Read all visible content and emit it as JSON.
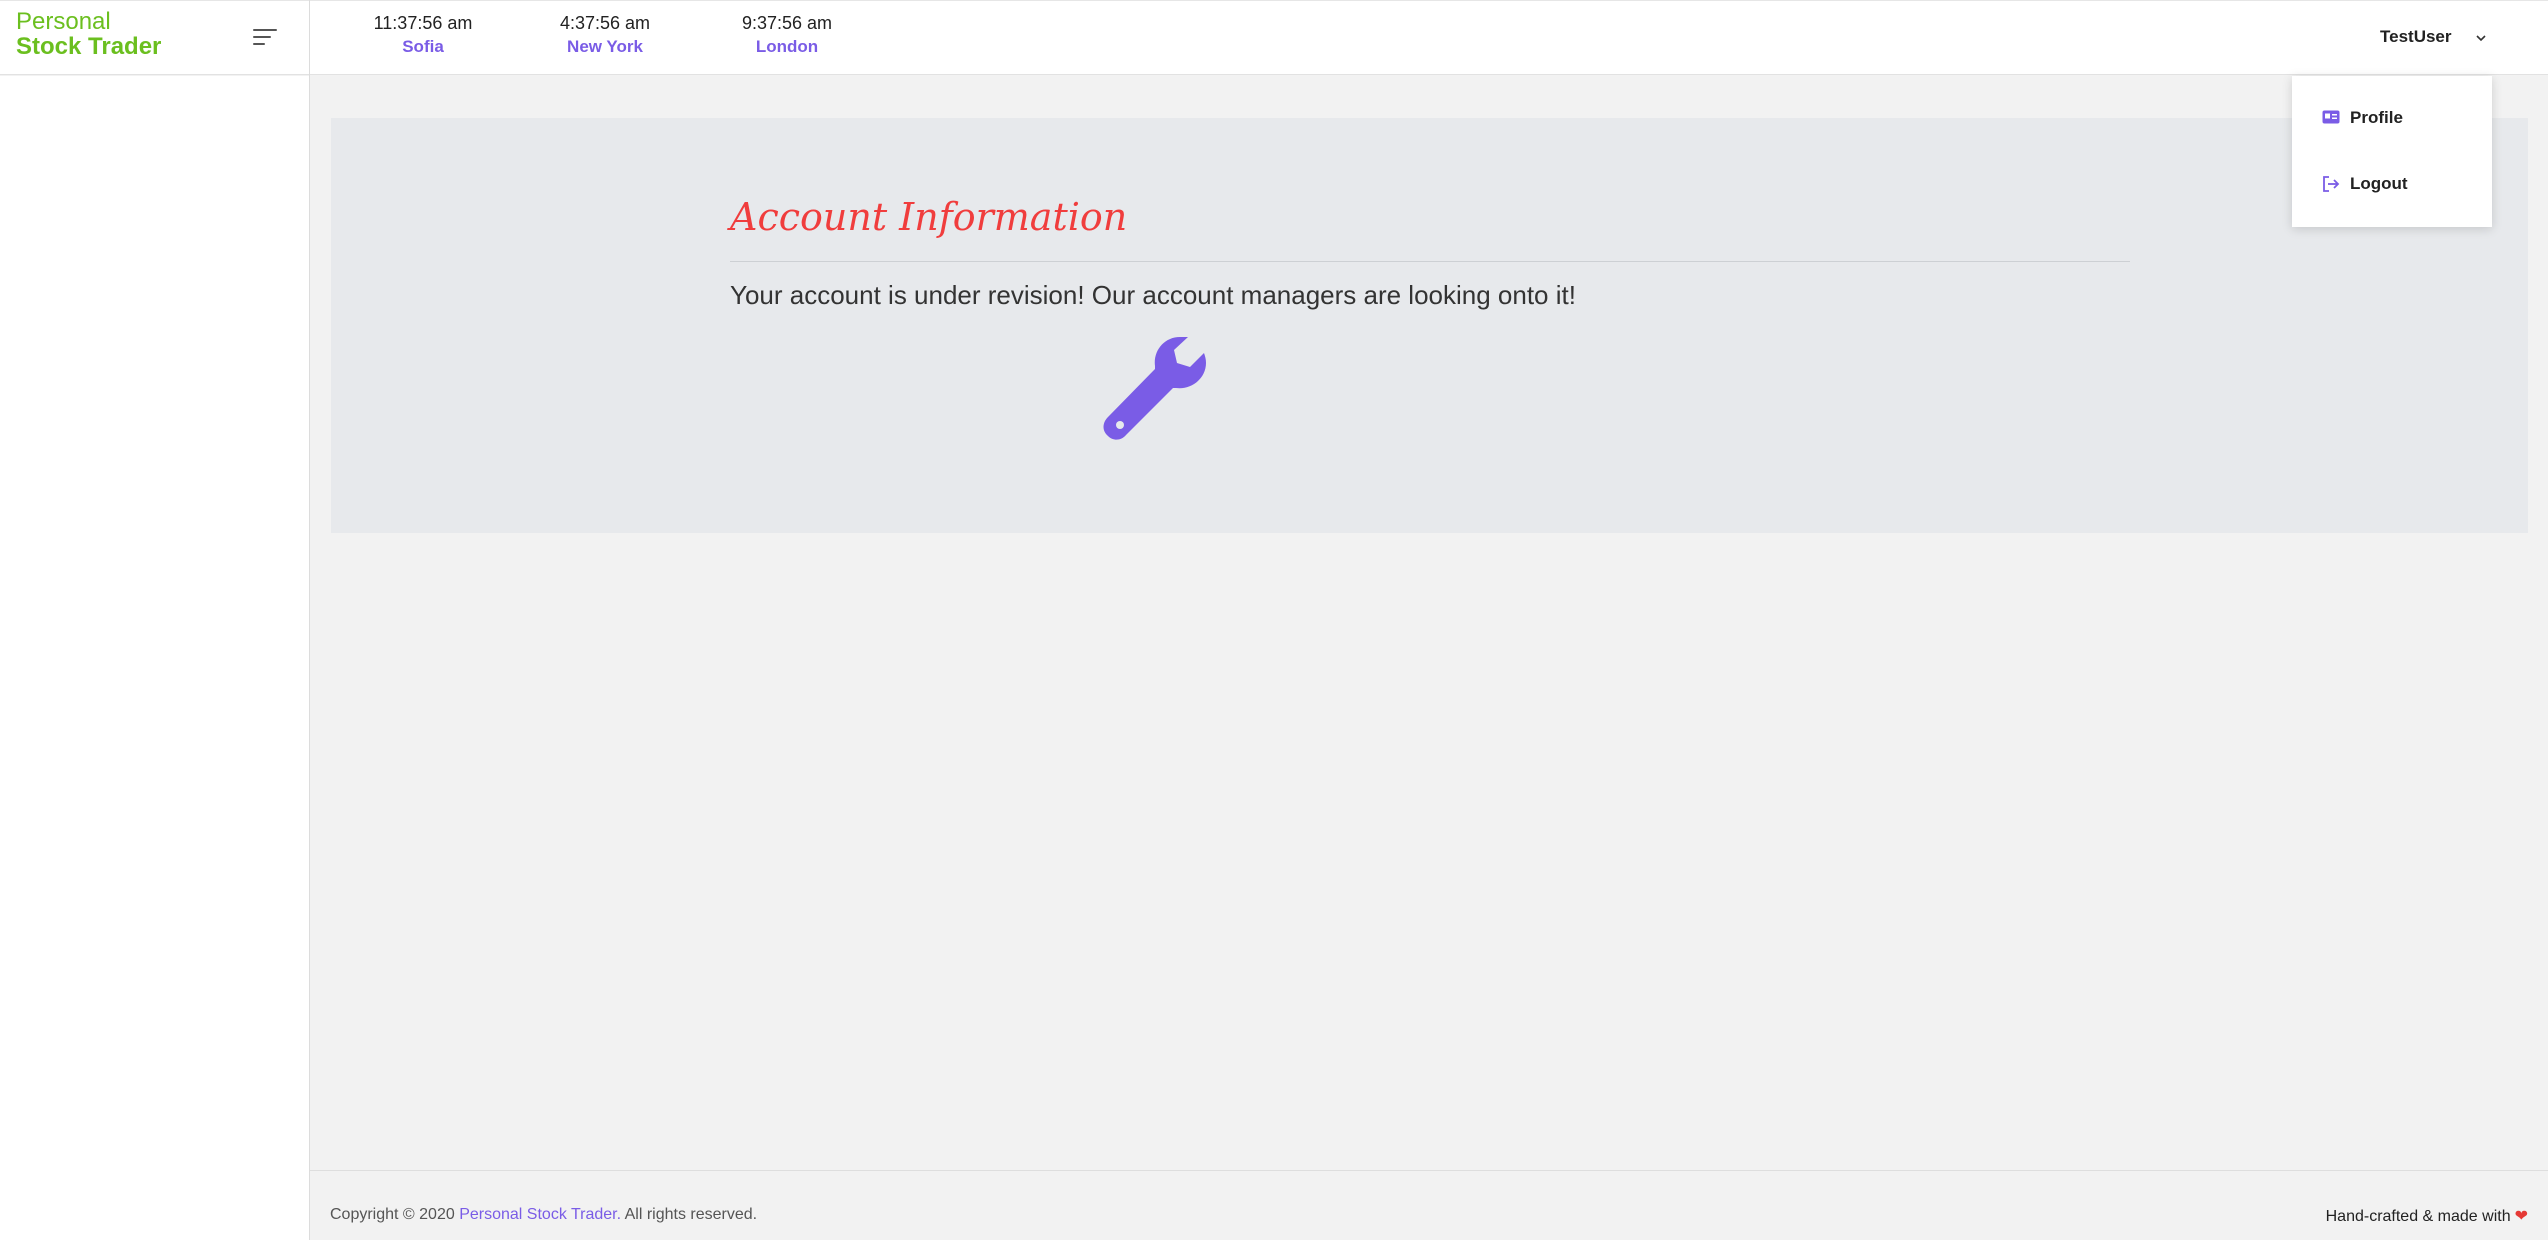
{
  "brand": {
    "line1": "Personal",
    "line2": "Stock Trader",
    "color": "#6bbf1f"
  },
  "clocks": [
    {
      "time": "11:37:56 am",
      "city": "Sofia"
    },
    {
      "time": "4:37:56 am",
      "city": "New York"
    },
    {
      "time": "9:37:56 am",
      "city": "London"
    }
  ],
  "user": {
    "name": "TestUser"
  },
  "dropdown": {
    "items": [
      {
        "label": "Profile",
        "icon": "id-card-icon"
      },
      {
        "label": "Logout",
        "icon": "logout-icon"
      }
    ]
  },
  "card": {
    "title": "Account Information",
    "message": "Your account is under revision! Our account managers are looking onto it!",
    "icon": "wrench-icon"
  },
  "footer": {
    "copy_prefix": "Copyright © 2020",
    "copy_link": "Personal Stock Trader.",
    "copy_suffix": "All rights reserved.",
    "made_with": "Hand-crafted & made with"
  },
  "colors": {
    "accent": "#7a5ce6",
    "title_red": "#f03d3d",
    "heart": "#e53935"
  }
}
